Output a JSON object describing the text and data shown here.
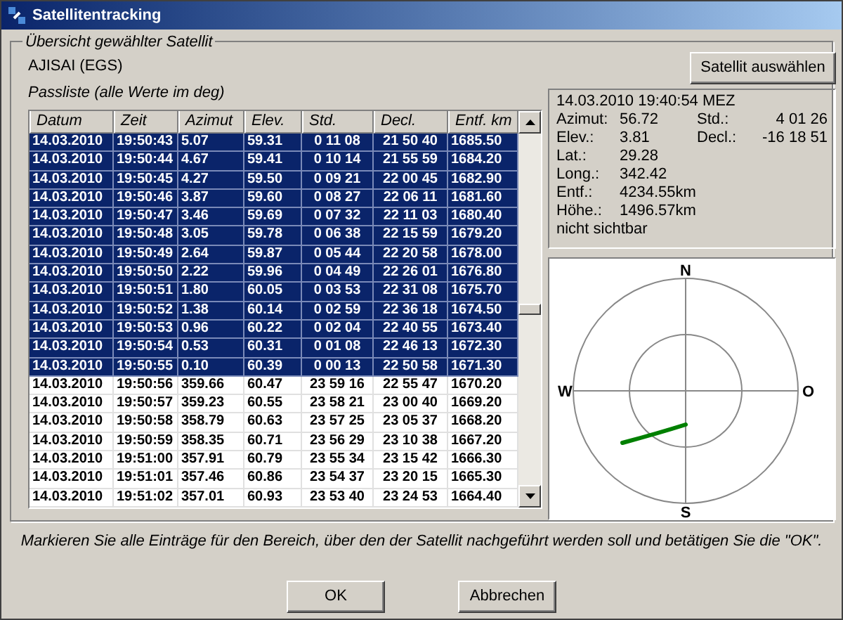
{
  "window": {
    "title": "Satellitentracking"
  },
  "group": {
    "title": "Übersicht gewählter Satellit",
    "satellite": "AJISAI (EGS)",
    "list_label": "Passliste (alle Werte im deg)"
  },
  "table": {
    "columns": [
      "Datum",
      "Zeit",
      "Azimut",
      "Elev.",
      "Std.",
      "Decl.",
      "Entf. km"
    ],
    "rows": [
      {
        "cells": [
          "14.03.2010",
          "19:50:43",
          "5.07",
          "59.31",
          "0 11 08",
          "21 50 40",
          "1685.50"
        ],
        "selected": true
      },
      {
        "cells": [
          "14.03.2010",
          "19:50:44",
          "4.67",
          "59.41",
          "0 10 14",
          "21 55 59",
          "1684.20"
        ],
        "selected": true
      },
      {
        "cells": [
          "14.03.2010",
          "19:50:45",
          "4.27",
          "59.50",
          "0 09 21",
          "22 00 45",
          "1682.90"
        ],
        "selected": true
      },
      {
        "cells": [
          "14.03.2010",
          "19:50:46",
          "3.87",
          "59.60",
          "0 08 27",
          "22 06 11",
          "1681.60"
        ],
        "selected": true
      },
      {
        "cells": [
          "14.03.2010",
          "19:50:47",
          "3.46",
          "59.69",
          "0 07 32",
          "22 11 03",
          "1680.40"
        ],
        "selected": true
      },
      {
        "cells": [
          "14.03.2010",
          "19:50:48",
          "3.05",
          "59.78",
          "0 06 38",
          "22 15 59",
          "1679.20"
        ],
        "selected": true
      },
      {
        "cells": [
          "14.03.2010",
          "19:50:49",
          "2.64",
          "59.87",
          "0 05 44",
          "22 20 58",
          "1678.00"
        ],
        "selected": true
      },
      {
        "cells": [
          "14.03.2010",
          "19:50:50",
          "2.22",
          "59.96",
          "0 04 49",
          "22 26 01",
          "1676.80"
        ],
        "selected": true
      },
      {
        "cells": [
          "14.03.2010",
          "19:50:51",
          "1.80",
          "60.05",
          "0 03 53",
          "22 31 08",
          "1675.70"
        ],
        "selected": true
      },
      {
        "cells": [
          "14.03.2010",
          "19:50:52",
          "1.38",
          "60.14",
          "0 02 59",
          "22 36 18",
          "1674.50"
        ],
        "selected": true
      },
      {
        "cells": [
          "14.03.2010",
          "19:50:53",
          "0.96",
          "60.22",
          "0 02 04",
          "22 40 55",
          "1673.40"
        ],
        "selected": true
      },
      {
        "cells": [
          "14.03.2010",
          "19:50:54",
          "0.53",
          "60.31",
          "0 01 08",
          "22 46 13",
          "1672.30"
        ],
        "selected": true
      },
      {
        "cells": [
          "14.03.2010",
          "19:50:55",
          "0.10",
          "60.39",
          "0 00 13",
          "22 50 58",
          "1671.30"
        ],
        "selected": true
      },
      {
        "cells": [
          "14.03.2010",
          "19:50:56",
          "359.66",
          "60.47",
          "23 59 16",
          "22 55 47",
          "1670.20"
        ],
        "selected": false
      },
      {
        "cells": [
          "14.03.2010",
          "19:50:57",
          "359.23",
          "60.55",
          "23 58 21",
          "23 00 40",
          "1669.20"
        ],
        "selected": false
      },
      {
        "cells": [
          "14.03.2010",
          "19:50:58",
          "358.79",
          "60.63",
          "23 57 25",
          "23 05 37",
          "1668.20"
        ],
        "selected": false
      },
      {
        "cells": [
          "14.03.2010",
          "19:50:59",
          "358.35",
          "60.71",
          "23 56 29",
          "23 10 38",
          "1667.20"
        ],
        "selected": false
      },
      {
        "cells": [
          "14.03.2010",
          "19:51:00",
          "357.91",
          "60.79",
          "23 55 34",
          "23 15 42",
          "1666.30"
        ],
        "selected": false
      },
      {
        "cells": [
          "14.03.2010",
          "19:51:01",
          "357.46",
          "60.86",
          "23 54 37",
          "23 20 15",
          "1665.30"
        ],
        "selected": false
      },
      {
        "cells": [
          "14.03.2010",
          "19:51:02",
          "357.01",
          "60.93",
          "23 53 40",
          "23 24 53",
          "1664.40"
        ],
        "selected": false
      }
    ]
  },
  "select_button": "Satellit auswählen",
  "info": {
    "timestamp": "14.03.2010 19:40:54 MEZ",
    "fields": [
      {
        "label": "Azimut:",
        "value": "56.72",
        "label2": "Std.:",
        "value2": "4 01 26"
      },
      {
        "label": "Elev.:",
        "value": "3.81",
        "label2": "Decl.:",
        "value2": "-16 18 51"
      },
      {
        "label": "Lat.:",
        "value": "29.28"
      },
      {
        "label": "Long.:",
        "value": "342.42"
      },
      {
        "label": "Entf.:",
        "value": "4234.55km"
      },
      {
        "label": "Höhe.:",
        "value": "1496.57km"
      }
    ],
    "status": "nicht sichtbar"
  },
  "sky_plot": {
    "north": "N",
    "south": "S",
    "west": "W",
    "east": "O"
  },
  "instruction": "Markieren Sie alle Einträge für den Bereich, über den der Satellit nachgeführt werden soll und betätigen Sie die \"OK\".",
  "buttons": [
    "OK",
    "Abbrechen"
  ]
}
